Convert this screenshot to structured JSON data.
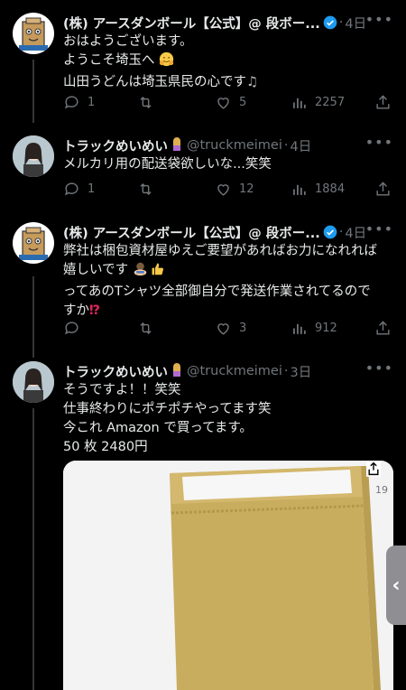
{
  "tweets": [
    {
      "name": "(株) アースダンボール【公式】@ 段ボー...",
      "handle": "",
      "time": "4日",
      "lines": [
        "おはようございます。",
        "ようこそ埼玉へ",
        "山田うどんは埼玉県民の心です"
      ],
      "reply": "1",
      "retweet": "",
      "like": "5",
      "views": "2257"
    },
    {
      "name": "トラックめいめい",
      "handle": "@truckmeimei",
      "time": "4日",
      "lines": [
        "メルカリ用の配送袋欲しいな...笑笑"
      ],
      "reply": "1",
      "retweet": "",
      "like": "12",
      "views": "1884"
    },
    {
      "name": "(株) アースダンボール【公式】@ 段ボー...",
      "handle": "",
      "time": "4日",
      "lines": [
        "弊社は梱包資材屋ゆえご要望があればお力になれれば",
        "嬉しいです",
        "ってあのTシャツ全部御自分で発送作業されてるので",
        "すか"
      ],
      "reply": "",
      "retweet": "",
      "like": "3",
      "views": "912"
    },
    {
      "name": "トラックめいめい",
      "handle": "@truckmeimei",
      "time": "3日",
      "lines": [
        "そうですよ！！笑笑",
        "仕事終わりにポチポチやってます笑",
        "今これ Amazon で買ってます。",
        "50 枚 2480円"
      ],
      "media_count": "19"
    }
  ],
  "colors": {
    "background": "#000000",
    "text": "#e7e9ea",
    "muted": "#71767b",
    "verified": "#1d9bf0"
  },
  "icons": [
    "reply-icon",
    "retweet-icon",
    "like-icon",
    "views-icon",
    "share-icon",
    "verified-icon",
    "more-icon"
  ]
}
